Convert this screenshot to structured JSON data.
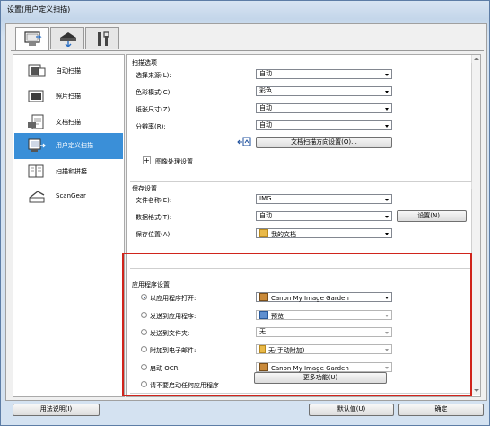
{
  "window": {
    "title": "设置(用户定义扫描)"
  },
  "tabs": [
    {
      "icon": "scan-settings-icon"
    },
    {
      "icon": "scanner-icon"
    },
    {
      "icon": "tools-icon"
    }
  ],
  "nav": [
    {
      "label": "自动扫描",
      "icon": "auto-scan-icon"
    },
    {
      "label": "照片扫描",
      "icon": "photo-scan-icon"
    },
    {
      "label": "文档扫描",
      "icon": "document-scan-icon"
    },
    {
      "label": "用户定义扫描",
      "icon": "custom-scan-icon",
      "selected": true
    },
    {
      "label": "扫描和拼接",
      "icon": "scan-stitch-icon"
    },
    {
      "label": "ScanGear",
      "icon": "scangear-icon"
    }
  ],
  "scan_options": {
    "title": "扫描选项",
    "rows": [
      {
        "label": "选择来源(L):",
        "value": "自动"
      },
      {
        "label": "色彩模式(C):",
        "value": "彩色"
      },
      {
        "label": "纸张尺寸(Z):",
        "value": "自动"
      },
      {
        "label": "分辨率(R):",
        "value": "自动"
      }
    ],
    "orientation_button": "文档扫描方向设置(O)...",
    "image_processing": "图像处理设置"
  },
  "save_settings": {
    "title": "保存设置",
    "file_name_label": "文件名称(E):",
    "file_name_value": "IMG",
    "format_label": "数据格式(T):",
    "format_value": "自动",
    "settings_button": "设置(N)...",
    "location_label": "保存位置(A):",
    "location_value": "我的文档"
  },
  "app_settings": {
    "title": "应用程序设置",
    "options": [
      {
        "label": "以应用程序打开:",
        "value": "Canon My Image Garden",
        "checked": true,
        "enabled": true
      },
      {
        "label": "发送到应用程序:",
        "value": "预览",
        "checked": false,
        "enabled": false
      },
      {
        "label": "发送到文件夹:",
        "value": "无",
        "checked": false,
        "enabled": false
      },
      {
        "label": "附加到电子邮件:",
        "value": "无(手动附加)",
        "checked": false,
        "enabled": false
      },
      {
        "label": "启动 OCR:",
        "value": "Canon My Image Garden",
        "checked": false,
        "enabled": false
      },
      {
        "label": "请不要启动任何应用程序",
        "checked": false
      }
    ],
    "more_button": "更多功能(U)"
  },
  "footer": {
    "help": "用法说明(I)",
    "defaults": "默认值(U)",
    "ok": "确定"
  },
  "colors": {
    "accent": "#3a8fd8",
    "highlight_border": "#d0241c"
  }
}
